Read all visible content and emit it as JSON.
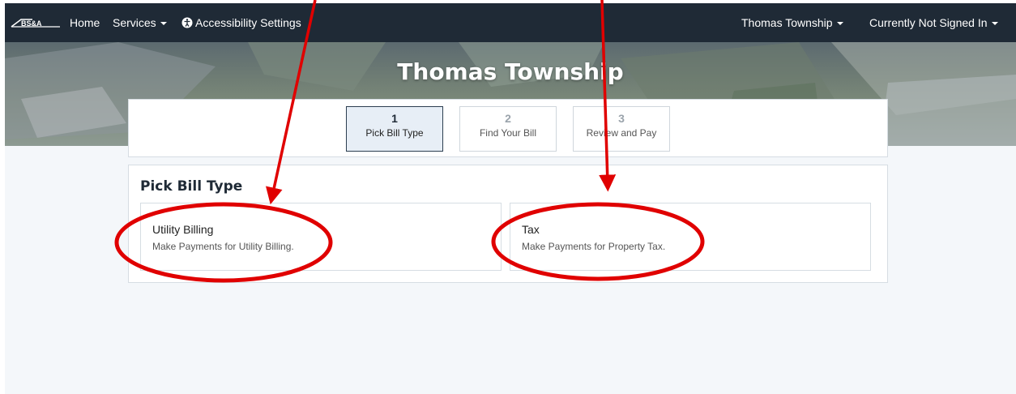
{
  "navbar": {
    "logo_text": "BS&A",
    "home": "Home",
    "services": "Services",
    "accessibility": "Accessibility Settings",
    "municipality": "Thomas Township",
    "user": "Currently Not Signed In"
  },
  "hero": {
    "title": "Thomas Township"
  },
  "steps": [
    {
      "number": "1",
      "label": "Pick Bill Type"
    },
    {
      "number": "2",
      "label": "Find Your Bill"
    },
    {
      "number": "3",
      "label": "Review and Pay"
    }
  ],
  "main": {
    "section_title": "Pick Bill Type",
    "cards": [
      {
        "title": "Utility Billing",
        "description": "Make Payments for Utility Billing."
      },
      {
        "title": "Tax",
        "description": "Make Payments for Property Tax."
      }
    ]
  },
  "colors": {
    "navbar": "#1f2a36",
    "annotation": "#e00000",
    "page_bg": "#f4f7fa"
  }
}
